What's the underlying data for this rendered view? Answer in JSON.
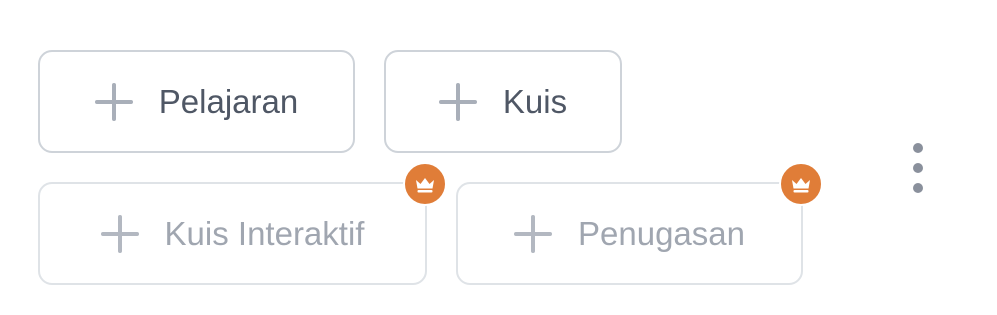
{
  "buttons": {
    "pelajaran": {
      "label": "Pelajaran",
      "icon": "plus-icon"
    },
    "kuis": {
      "label": "Kuis",
      "icon": "plus-icon"
    },
    "kuis_interaktif": {
      "label": "Kuis Interaktif",
      "icon": "plus-icon",
      "premium": true
    },
    "penugasan": {
      "label": "Penugasan",
      "icon": "plus-icon",
      "premium": true
    }
  },
  "badge": {
    "icon": "crown-icon",
    "color": "#e07d38"
  },
  "menu": {
    "icon": "more-vertical-icon"
  }
}
